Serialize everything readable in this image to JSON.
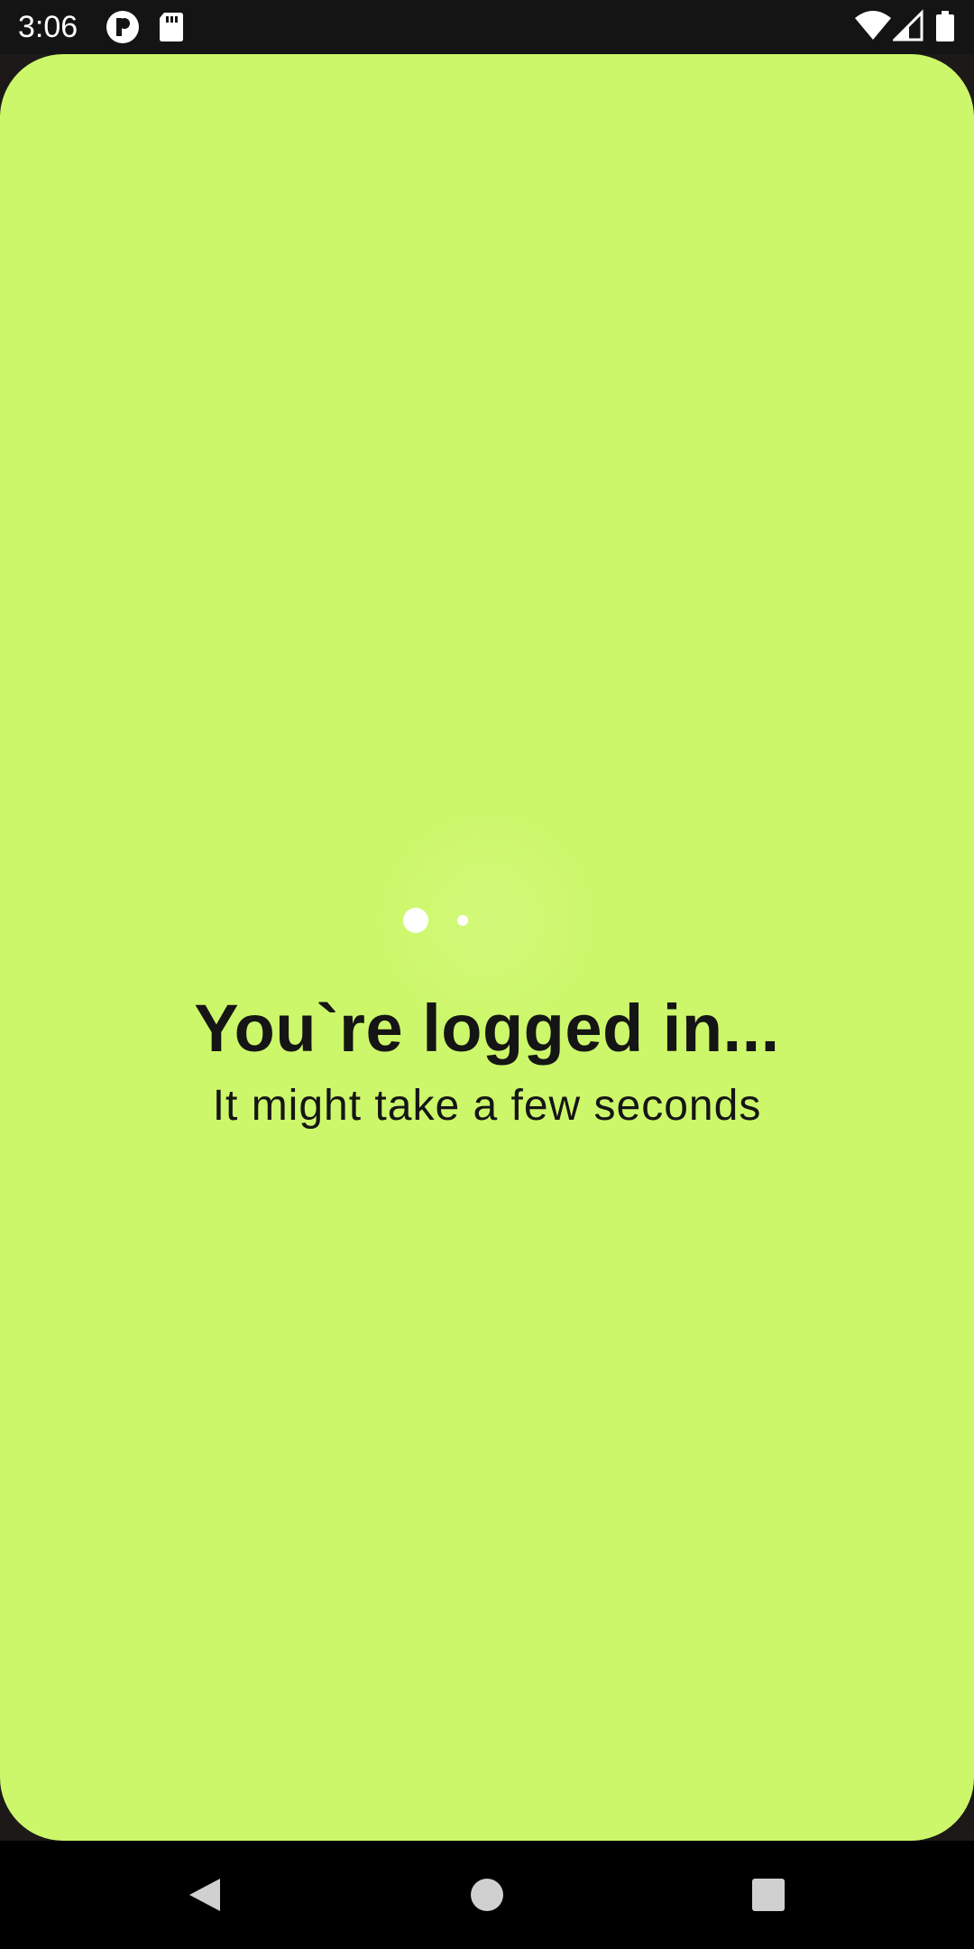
{
  "status_bar": {
    "time": "3:06",
    "icons": [
      "p-circle-icon",
      "sd-card-icon",
      "wifi-icon",
      "cellular-signal-icon",
      "battery-icon"
    ]
  },
  "main": {
    "title": "You`re logged in...",
    "subtitle": "It might take a few seconds",
    "background_color": "#ccf76a"
  },
  "navigation": {
    "buttons": [
      "back-icon",
      "home-icon",
      "recents-icon"
    ]
  }
}
